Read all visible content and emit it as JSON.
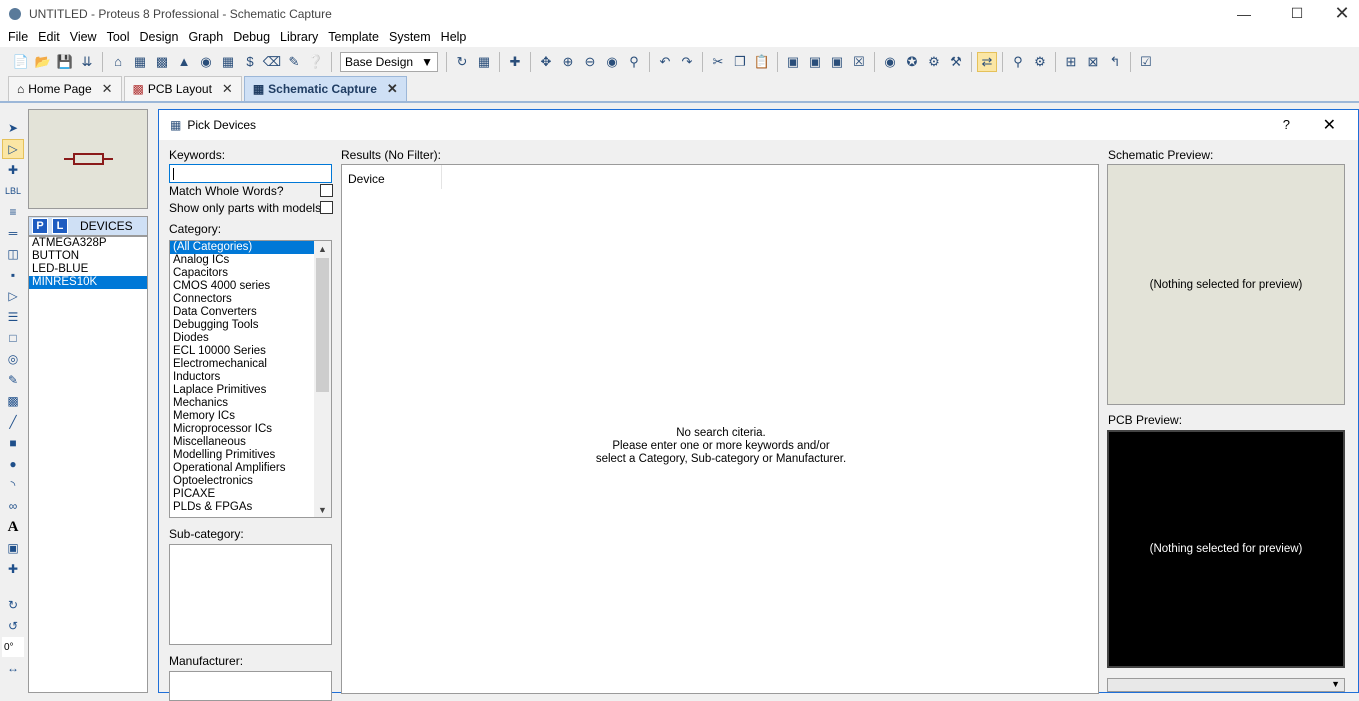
{
  "window": {
    "title": "UNTITLED - Proteus 8 Professional - Schematic Capture"
  },
  "menu": [
    "File",
    "Edit",
    "View",
    "Tool",
    "Design",
    "Graph",
    "Debug",
    "Library",
    "Template",
    "System",
    "Help"
  ],
  "toolbar": {
    "design_combo": "Base Design"
  },
  "tabs": [
    {
      "label": "Home Page",
      "icon": "home-icon"
    },
    {
      "label": "PCB Layout",
      "icon": "pcb-icon"
    },
    {
      "label": "Schematic Capture",
      "icon": "schematic-icon"
    }
  ],
  "left_tools": {
    "rotation": "0°"
  },
  "devices_panel": {
    "p_label": "P",
    "l_label": "L",
    "header": "DEVICES",
    "items": [
      "ATMEGA328P",
      "BUTTON",
      "LED-BLUE",
      "MINRES10K"
    ],
    "selected": "MINRES10K"
  },
  "dialog": {
    "title": "Pick Devices",
    "help": "?",
    "keywords_label": "Keywords:",
    "keywords_value": "",
    "match_whole_words": "Match Whole Words?",
    "show_only_models": "Show only parts with models?",
    "category_label": "Category:",
    "categories": [
      "(All Categories)",
      "Analog ICs",
      "Capacitors",
      "CMOS 4000 series",
      "Connectors",
      "Data Converters",
      "Debugging Tools",
      "Diodes",
      "ECL 10000 Series",
      "Electromechanical",
      "Inductors",
      "Laplace Primitives",
      "Mechanics",
      "Memory ICs",
      "Microprocessor ICs",
      "Miscellaneous",
      "Modelling Primitives",
      "Operational Amplifiers",
      "Optoelectronics",
      "PICAXE",
      "PLDs & FPGAs"
    ],
    "subcategory_label": "Sub-category:",
    "manufacturer_label": "Manufacturer:",
    "results_label": "Results (No Filter):",
    "results_column": "Device",
    "no_search_1": "No search citeria.",
    "no_search_2": "Please enter one or more keywords and/or",
    "no_search_3": "select a Category, Sub-category or Manufacturer.",
    "schematic_preview_label": "Schematic Preview:",
    "schematic_preview_text": "(Nothing selected for preview)",
    "pcb_preview_label": "PCB Preview:",
    "pcb_preview_text": "(Nothing selected for preview)"
  },
  "colors": {
    "accent": "#0078d7",
    "tab_active": "#cfe0f5",
    "preview_bg": "#e3e3d8"
  }
}
